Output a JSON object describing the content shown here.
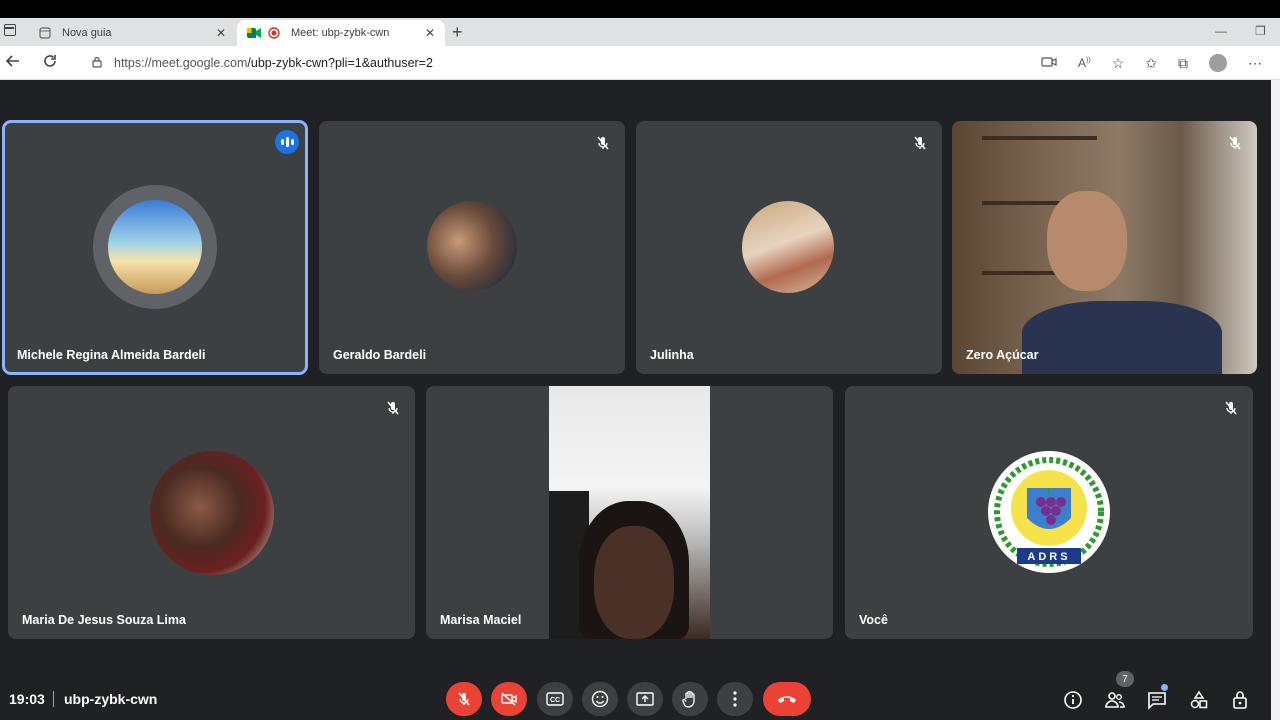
{
  "browser": {
    "tabs": [
      {
        "label": "Nova guia",
        "active": false
      },
      {
        "label": "Meet: ubp-zybk-cwn",
        "active": true
      }
    ],
    "url_host": "https://meet.google.com",
    "url_path": "/ubp-zybk-cwn?pli=1&authuser=2"
  },
  "participants": [
    {
      "name": "Michele Regina Almeida Bardeli",
      "speaking": true
    },
    {
      "name": "Geraldo Bardeli",
      "muted": true
    },
    {
      "name": "Julinha",
      "muted": true
    },
    {
      "name": "Zero Açúcar",
      "muted": true
    },
    {
      "name": "Maria De Jesus Souza Lima",
      "muted": true
    },
    {
      "name": "Marisa Maciel",
      "muted": false
    },
    {
      "name": "Você",
      "muted": true
    }
  ],
  "logo_text": "ADRS",
  "bottom": {
    "time": "19:03",
    "meeting_code": "ubp-zybk-cwn",
    "participant_count": "7"
  },
  "colors": {
    "background": "#202124",
    "tile": "#3c4043",
    "accent": "#1a73e8",
    "danger": "#ea4335"
  }
}
